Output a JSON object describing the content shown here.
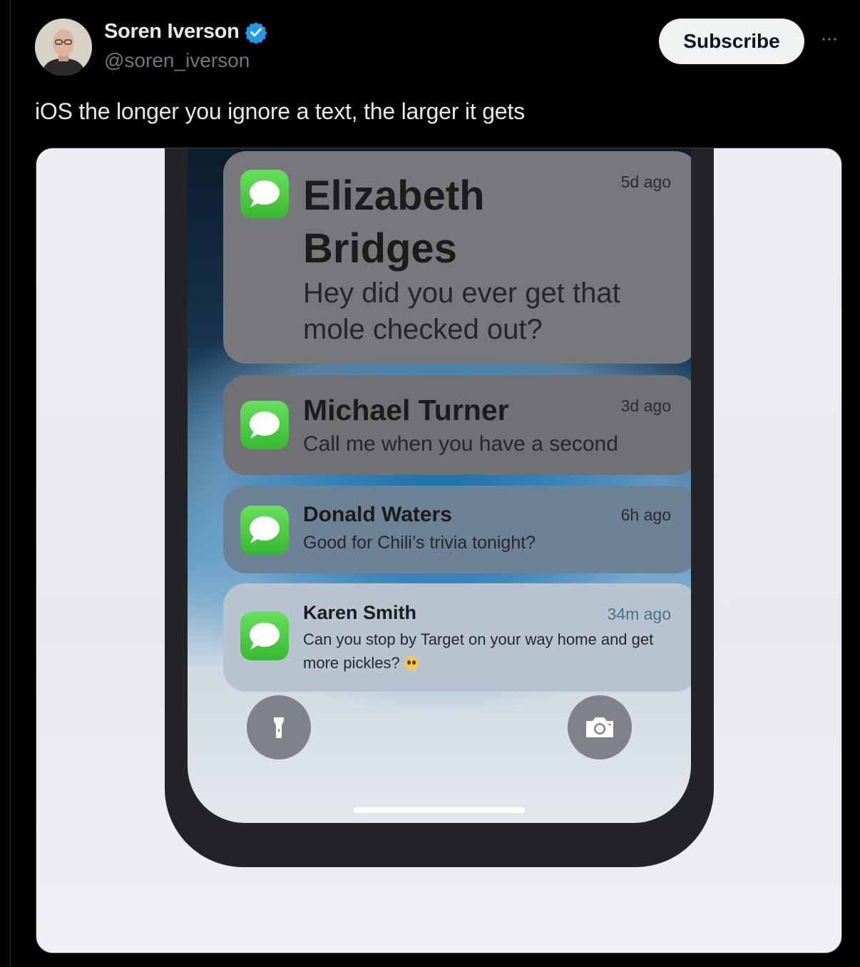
{
  "post": {
    "display_name": "Soren Iverson",
    "handle": "@soren_iverson",
    "subscribe_label": "Subscribe",
    "more_label": "···",
    "text": "iOS the longer you ignore a text, the larger it gets"
  },
  "colors": {
    "verified_badge": "#1d9bf0",
    "messages_icon": "#3fc236",
    "subscribe_bg": "#eff3f4"
  },
  "notifications": [
    {
      "app": "messages",
      "sender": "Elizabeth Bridges",
      "message": "Hey did you ever get that mole checked out?",
      "time": "5d ago"
    },
    {
      "app": "messages",
      "sender": "Michael Turner",
      "message": "Call me when you have a second",
      "time": "3d ago"
    },
    {
      "app": "messages",
      "sender": "Donald Waters",
      "message": "Good for Chili’s trivia tonight?",
      "time": "6h ago"
    },
    {
      "app": "messages",
      "sender": "Karen Smith",
      "message": "Can you stop by Target on your way home and get more pickles?",
      "time": "34m ago",
      "emoji": "pleading-face"
    }
  ],
  "lock_screen": {
    "left_button_icon": "flashlight-icon",
    "right_button_icon": "camera-icon"
  }
}
